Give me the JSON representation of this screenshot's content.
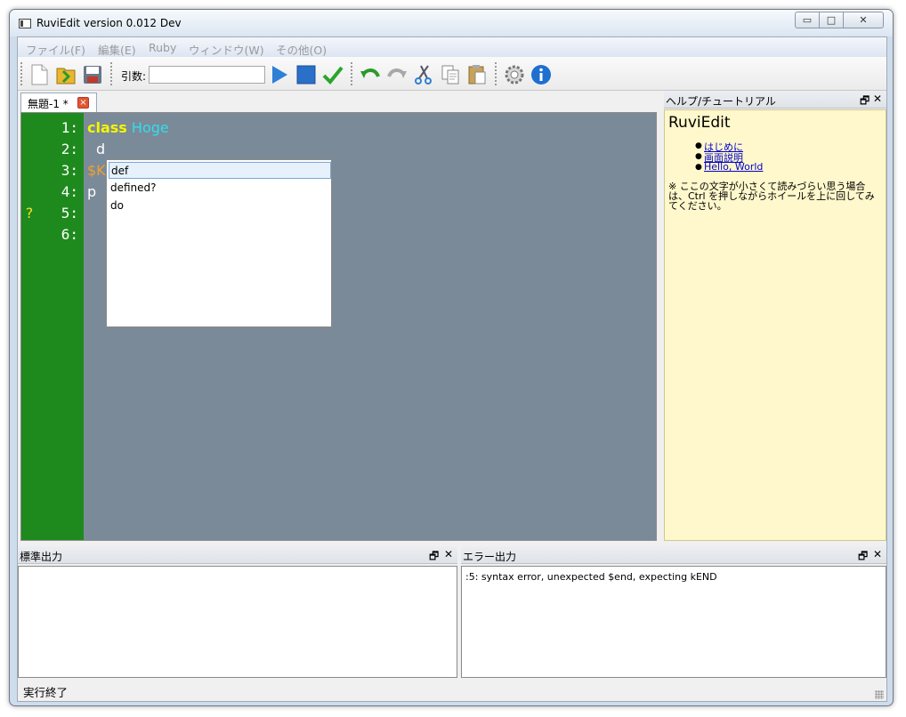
{
  "window": {
    "title": "RuviEdit version 0.012 Dev",
    "min_glyph": "▭",
    "max_glyph": "□",
    "close_glyph": "✕"
  },
  "menu": [
    "ファイル(F)",
    "編集(E)",
    "Ruby",
    "ウィンドウ(W)",
    "その他(O)"
  ],
  "toolbar": {
    "args_label": "引数:",
    "args_value": ""
  },
  "tabs": [
    {
      "label": "無題-1 *",
      "close_glyph": "×"
    }
  ],
  "editor": {
    "line_numbers": [
      "1:",
      "2:",
      "3:",
      "4:",
      "5:",
      "6:"
    ],
    "error_marker": "?",
    "code": {
      "l1_keyword": "class",
      "l1_name": "Hoge",
      "l2_text": "d",
      "l3_text": "$K",
      "l4_text": "p"
    },
    "colors": {
      "gutter": "#1e8a1e",
      "background": "#7a8a98",
      "keyword": "#f5f500",
      "classname": "#33ddee"
    }
  },
  "autocomplete": [
    "def",
    "defined?",
    "do"
  ],
  "help_panel": {
    "header": "ヘルプ/チュートリアル",
    "title": "RuviEdit",
    "links": [
      "はじめに",
      "画面説明",
      "Hello, World"
    ],
    "note": "※ ここの文字が小さくて読みづらい思う場合は、Ctrl を押しながらホイールを上に回してみてください。"
  },
  "panel_buttons": {
    "float": "🗗",
    "close": "✕"
  },
  "stdout_panel": {
    "header": "標準出力",
    "content": ""
  },
  "stderr_panel": {
    "header": "エラー出力",
    "content": ":5: syntax error, unexpected $end, expecting kEND"
  },
  "status": {
    "text": "実行終了"
  }
}
